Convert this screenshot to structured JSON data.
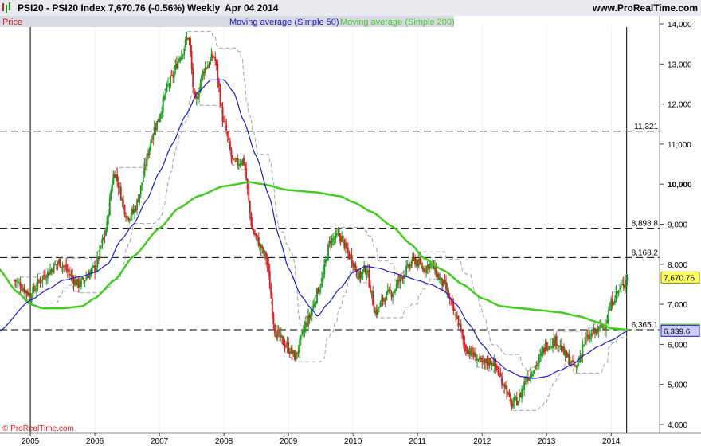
{
  "header": {
    "instrument": "PSI20 - PSI20 Index",
    "price_change": "7,670.76 (-0.56%)",
    "period": "Weekly",
    "date": "Apr 04 2014",
    "website": "www.ProRealTime.com"
  },
  "legend": {
    "price": "Price",
    "ma50": "Moving average (Simple 50)",
    "ma200": "Moving average (Simple 200)"
  },
  "watermark": "© ProRealTime.com",
  "colors": {
    "up_candle": "#1a9a1a",
    "down_candle": "#d42020",
    "ma50": "#1a1acc",
    "ma200": "#44cc22",
    "channel": "#9aa4b8",
    "price_tag_bg": "#ffff66",
    "ma200_tag_bg": "#ccffcc",
    "ma50_tag_bg": "#ccccff"
  },
  "chart_data": {
    "type": "candlestick",
    "x_ticks": [
      "2005",
      "2006",
      "2007",
      "2008",
      "2009",
      "2010",
      "2011",
      "2012",
      "2013",
      "2014"
    ],
    "y_ticks": [
      "14,000",
      "13,000",
      "12,000",
      "11,000",
      "10,000",
      "9,000",
      "8,000",
      "7,000",
      "6,000",
      "5,000",
      "4,000"
    ],
    "ylim": [
      4000,
      14000
    ],
    "price_knots": [
      [
        2004.75,
        7600
      ],
      [
        2005.0,
        7250
      ],
      [
        2005.2,
        7700
      ],
      [
        2005.45,
        8050
      ],
      [
        2005.75,
        7500
      ],
      [
        2006.0,
        7900
      ],
      [
        2006.15,
        8700
      ],
      [
        2006.3,
        10300
      ],
      [
        2006.5,
        9200
      ],
      [
        2006.6,
        9300
      ],
      [
        2006.95,
        11500
      ],
      [
        2007.15,
        12500
      ],
      [
        2007.35,
        13300
      ],
      [
        2007.45,
        13700
      ],
      [
        2007.55,
        12000
      ],
      [
        2007.7,
        12900
      ],
      [
        2007.85,
        13200
      ],
      [
        2008.0,
        11500
      ],
      [
        2008.15,
        10500
      ],
      [
        2008.3,
        10600
      ],
      [
        2008.45,
        8800
      ],
      [
        2008.65,
        8200
      ],
      [
        2008.8,
        6300
      ],
      [
        2008.95,
        6000
      ],
      [
        2009.1,
        5700
      ],
      [
        2009.3,
        6600
      ],
      [
        2009.5,
        7500
      ],
      [
        2009.65,
        8600
      ],
      [
        2009.8,
        8700
      ],
      [
        2009.95,
        8200
      ],
      [
        2010.1,
        7700
      ],
      [
        2010.2,
        7900
      ],
      [
        2010.35,
        6800
      ],
      [
        2010.5,
        7200
      ],
      [
        2010.6,
        7300
      ],
      [
        2010.8,
        7800
      ],
      [
        2010.95,
        8100
      ],
      [
        2011.1,
        7900
      ],
      [
        2011.2,
        8000
      ],
      [
        2011.4,
        7500
      ],
      [
        2011.6,
        6700
      ],
      [
        2011.75,
        5900
      ],
      [
        2011.9,
        5700
      ],
      [
        2012.0,
        5500
      ],
      [
        2012.15,
        5600
      ],
      [
        2012.35,
        5000
      ],
      [
        2012.45,
        4500
      ],
      [
        2012.55,
        4600
      ],
      [
        2012.7,
        5200
      ],
      [
        2012.85,
        5500
      ],
      [
        2013.0,
        6000
      ],
      [
        2013.15,
        6100
      ],
      [
        2013.3,
        5700
      ],
      [
        2013.45,
        5400
      ],
      [
        2013.6,
        6100
      ],
      [
        2013.75,
        6300
      ],
      [
        2013.9,
        6500
      ],
      [
        2014.05,
        7200
      ],
      [
        2014.15,
        7400
      ],
      [
        2014.26,
        7670.76
      ]
    ],
    "ma50_knots": [
      [
        2004.5,
        6300
      ],
      [
        2005.0,
        7100
      ],
      [
        2005.3,
        7400
      ],
      [
        2005.5,
        7600
      ],
      [
        2005.8,
        7700
      ],
      [
        2006.0,
        7800
      ],
      [
        2006.2,
        8000
      ],
      [
        2006.4,
        8600
      ],
      [
        2006.6,
        9000
      ],
      [
        2006.8,
        9600
      ],
      [
        2007.0,
        10300
      ],
      [
        2007.2,
        11000
      ],
      [
        2007.4,
        11700
      ],
      [
        2007.6,
        12300
      ],
      [
        2007.8,
        12600
      ],
      [
        2008.0,
        12600
      ],
      [
        2008.15,
        12300
      ],
      [
        2008.3,
        11600
      ],
      [
        2008.5,
        10700
      ],
      [
        2008.7,
        9700
      ],
      [
        2008.85,
        8700
      ],
      [
        2009.0,
        7900
      ],
      [
        2009.2,
        7200
      ],
      [
        2009.35,
        6900
      ],
      [
        2009.45,
        6700
      ],
      [
        2009.6,
        7000
      ],
      [
        2009.8,
        7400
      ],
      [
        2010.0,
        7800
      ],
      [
        2010.2,
        7950
      ],
      [
        2010.4,
        7900
      ],
      [
        2010.6,
        7800
      ],
      [
        2010.8,
        7700
      ],
      [
        2011.0,
        7600
      ],
      [
        2011.2,
        7500
      ],
      [
        2011.4,
        7350
      ],
      [
        2011.6,
        7000
      ],
      [
        2011.8,
        6500
      ],
      [
        2012.0,
        6000
      ],
      [
        2012.2,
        5600
      ],
      [
        2012.4,
        5350
      ],
      [
        2012.6,
        5200
      ],
      [
        2012.8,
        5150
      ],
      [
        2013.0,
        5200
      ],
      [
        2013.2,
        5350
      ],
      [
        2013.4,
        5500
      ],
      [
        2013.6,
        5750
      ],
      [
        2013.8,
        5950
      ],
      [
        2014.0,
        6100
      ],
      [
        2014.26,
        6339.6
      ]
    ],
    "ma200_knots": [
      [
        2004.5,
        7900
      ],
      [
        2004.8,
        7300
      ],
      [
        2005.0,
        7000
      ],
      [
        2005.2,
        6900
      ],
      [
        2005.5,
        6900
      ],
      [
        2005.8,
        6950
      ],
      [
        2006.0,
        7150
      ],
      [
        2006.3,
        7600
      ],
      [
        2006.6,
        8200
      ],
      [
        2007.0,
        8900
      ],
      [
        2007.3,
        9400
      ],
      [
        2007.6,
        9700
      ],
      [
        2008.0,
        9950
      ],
      [
        2008.4,
        10050
      ],
      [
        2008.6,
        10000
      ],
      [
        2009.0,
        9850
      ],
      [
        2009.4,
        9800
      ],
      [
        2009.8,
        9700
      ],
      [
        2010.0,
        9550
      ],
      [
        2010.3,
        9300
      ],
      [
        2010.6,
        8950
      ],
      [
        2010.9,
        8500
      ],
      [
        2011.1,
        8150
      ],
      [
        2011.4,
        7850
      ],
      [
        2011.7,
        7500
      ],
      [
        2012.0,
        7150
      ],
      [
        2012.3,
        6950
      ],
      [
        2012.6,
        6900
      ],
      [
        2012.9,
        6850
      ],
      [
        2013.2,
        6800
      ],
      [
        2013.5,
        6700
      ],
      [
        2013.8,
        6550
      ],
      [
        2014.0,
        6400
      ],
      [
        2014.26,
        6365.1
      ]
    ],
    "price_levels": [
      "11,321",
      "8,898.8",
      "8,168.2",
      "6,365.1"
    ],
    "level_values": [
      11321,
      8898.8,
      8168.2,
      6365.1
    ],
    "vertical_markers": [
      2005.0,
      2014.24
    ],
    "last_price": "7,670.76",
    "ma50_last": "6,339.6",
    "ma200_last": "6,365.1",
    "x_start": 2004.53,
    "x_end": 2014.75
  }
}
